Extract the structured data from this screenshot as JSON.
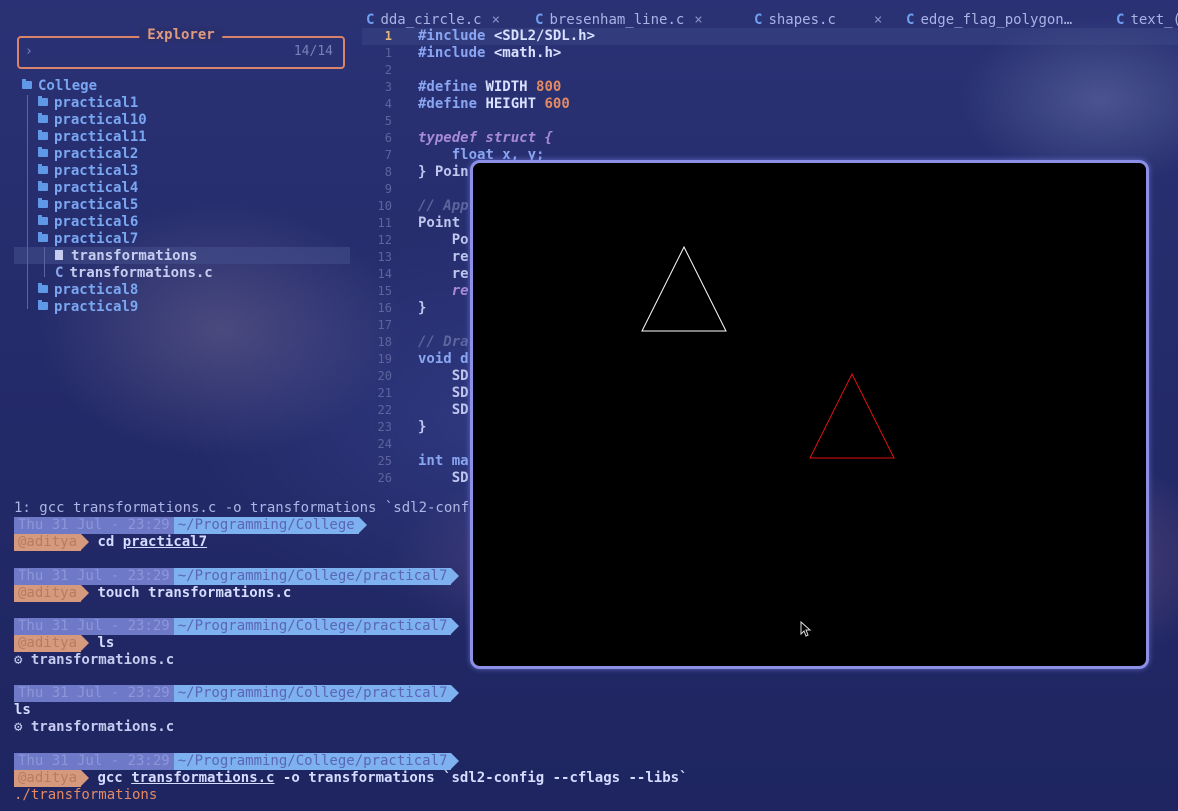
{
  "editor": {
    "tabs": [
      {
        "icon": "C",
        "label": "dda_circle.c",
        "close": "×"
      },
      {
        "icon": "C",
        "label": "bresenham_line.c",
        "close": "×"
      },
      {
        "icon": "C",
        "label": "shapes.c",
        "close": "×"
      },
      {
        "icon": "C",
        "label": "edge_flag_polygon…",
        "close": "×"
      },
      {
        "icon": "C",
        "label": "text_(",
        "close": ""
      }
    ],
    "line_numbers": [
      "1",
      "1",
      "2",
      "3",
      "4",
      "5",
      "6",
      "7",
      "8",
      "9",
      "10",
      "11",
      "12",
      "13",
      "14",
      "15",
      "16",
      "17",
      "18",
      "19",
      "20",
      "21",
      "22",
      "23",
      "24",
      "25",
      "26"
    ]
  },
  "explorer": {
    "title": "Explorer",
    "prompt": "›",
    "count": "14/14",
    "root": "College",
    "items": [
      {
        "label": "practical1",
        "type": "folder"
      },
      {
        "label": "practical10",
        "type": "folder"
      },
      {
        "label": "practical11",
        "type": "folder"
      },
      {
        "label": "practical2",
        "type": "folder"
      },
      {
        "label": "practical3",
        "type": "folder"
      },
      {
        "label": "practical4",
        "type": "folder"
      },
      {
        "label": "practical5",
        "type": "folder"
      },
      {
        "label": "practical6",
        "type": "folder"
      },
      {
        "label": "practical7",
        "type": "folder"
      },
      {
        "label": "transformations",
        "type": "binary"
      },
      {
        "label": "transformations.c",
        "type": "c-file",
        "icon": "C"
      },
      {
        "label": "practical8",
        "type": "folder"
      },
      {
        "label": "practical9",
        "type": "folder"
      }
    ]
  },
  "code_text": {
    "inc1_kw": "#include",
    "inc1_val": "<SDL2/SDL.h>",
    "inc2_kw": "#include",
    "inc2_val": "<math.h>",
    "def1_kw": "#define",
    "def1_name": "WIDTH",
    "def1_val": "800",
    "def2_kw": "#define",
    "def2_name": "HEIGHT",
    "def2_val": "600",
    "typedef_line": "typedef struct {",
    "float_line": "    float x, y;",
    "point_end": "} Poin",
    "cmt_app": "// App",
    "point_fn": "Point ",
    "po": "    Po",
    "re1": "    re",
    "re2": "    re",
    "re3": "    re",
    "brace1": "}",
    "cmt_dra": "// Dra",
    "void_d": "void d",
    "sd1": "    SD",
    "sd2": "    SD",
    "sd3": "    SD",
    "brace2": "}",
    "int_ma": "int ma",
    "sd4": "    SD"
  },
  "terminal": {
    "job": "1: gcc transformations.c -o transformations `sdl2-conf",
    "blocks": [
      {
        "date": "Thu 31 Jul - 23:29",
        "path": "~/Programming/College",
        "user": "@aditya",
        "cmd": "cd",
        "arg": "practical7",
        "output": ""
      },
      {
        "date": "Thu 31 Jul - 23:29",
        "path": "~/Programming/College/practical7",
        "user": "@aditya",
        "cmd": "touch",
        "arg": "transformations.c",
        "output": ""
      },
      {
        "date": "Thu 31 Jul - 23:29",
        "path": "~/Programming/College/practical7",
        "user": "@aditya",
        "cmd": "ls",
        "arg": "",
        "output": "⚙ transformations.c"
      },
      {
        "date": "Thu 31 Jul - 23:29",
        "path": "~/Programming/College/practical7",
        "user": "",
        "cmd": "ls",
        "arg": "",
        "output": "⚙ transformations.c"
      },
      {
        "date": "Thu 31 Jul - 23:29",
        "path": "~/Programming/College/practical7",
        "user": "@aditya",
        "cmd": "gcc",
        "arg": "transformations.c",
        "rest": " -o transformations `sdl2-config --cflags --libs`",
        "output": "./transformations"
      }
    ]
  },
  "sdl": {
    "triangles": [
      {
        "color": "#ffffff",
        "label": "white-triangle"
      },
      {
        "color": "#e01010",
        "label": "red-triangle"
      }
    ]
  }
}
